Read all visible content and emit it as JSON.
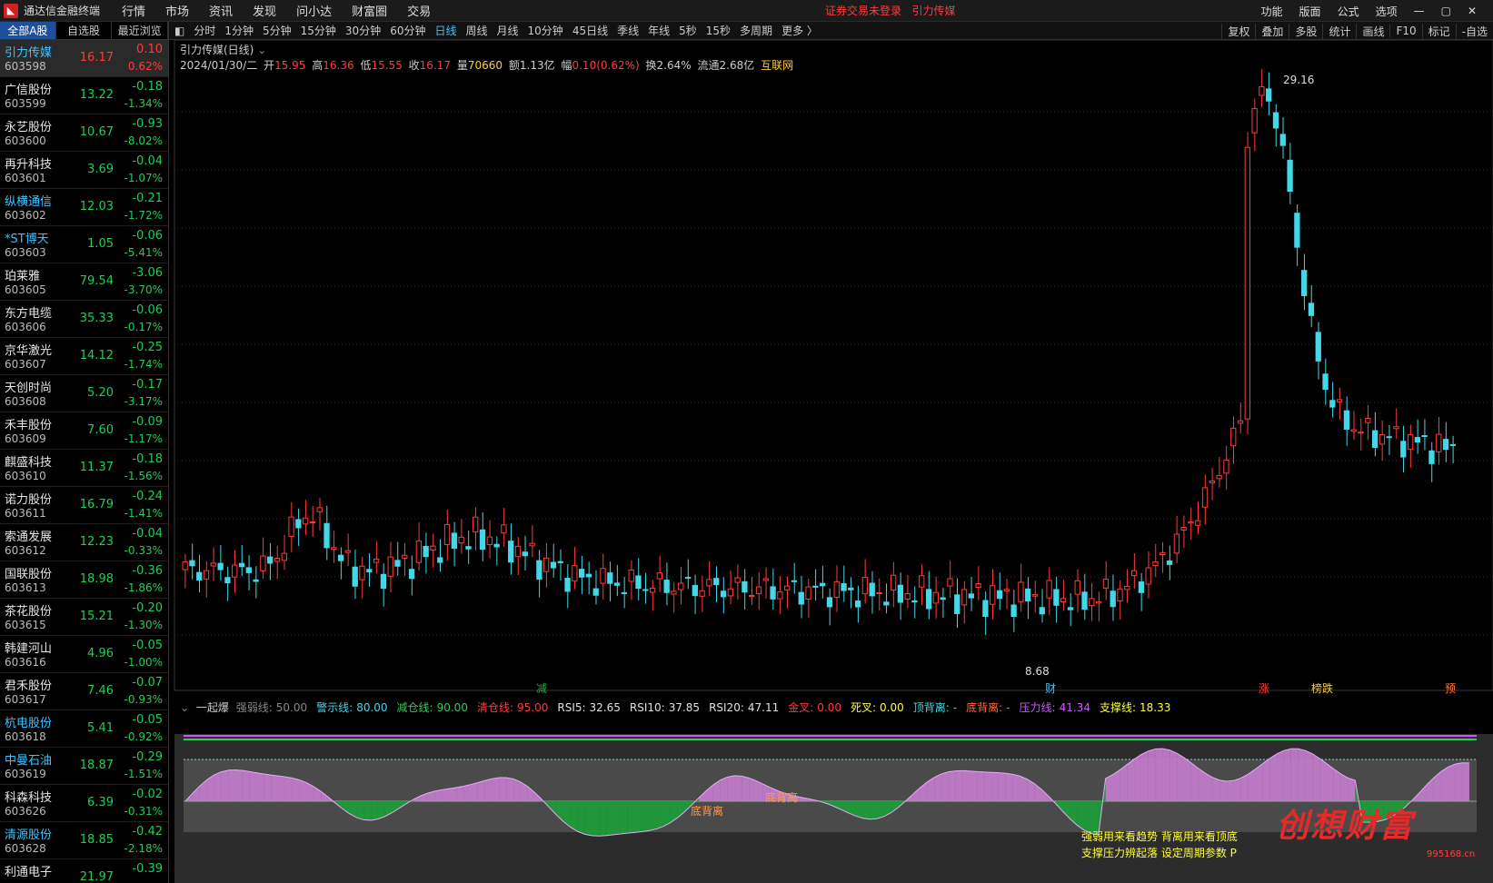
{
  "app": {
    "title": "通达信金融终端",
    "notice": "证券交易未登录",
    "current_stock": "引力传媒"
  },
  "menu": [
    "行情",
    "市场",
    "资讯",
    "发现",
    "问小达",
    "财富圈",
    "交易"
  ],
  "top_right": [
    "功能",
    "版面",
    "公式",
    "选项"
  ],
  "left_tabs": [
    "全部A股",
    "自选股",
    "最近浏览"
  ],
  "stocks": [
    {
      "name": "引力传媒",
      "code": "603598",
      "price": "16.17",
      "chg": "0.10",
      "pct": "0.62%",
      "dir": "up",
      "hl": true,
      "sel": true
    },
    {
      "name": "广信股份",
      "code": "603599",
      "price": "13.22",
      "chg": "-0.18",
      "pct": "-1.34%",
      "dir": "down"
    },
    {
      "name": "永艺股份",
      "code": "603600",
      "price": "10.67",
      "chg": "-0.93",
      "pct": "-8.02%",
      "dir": "down"
    },
    {
      "name": "再升科技",
      "code": "603601",
      "price": "3.69",
      "chg": "-0.04",
      "pct": "-1.07%",
      "dir": "down"
    },
    {
      "name": "纵横通信",
      "code": "603602",
      "price": "12.03",
      "chg": "-0.21",
      "pct": "-1.72%",
      "dir": "down",
      "hl": true
    },
    {
      "name": "*ST博天",
      "code": "603603",
      "price": "1.05",
      "chg": "-0.06",
      "pct": "-5.41%",
      "dir": "down",
      "hl": true
    },
    {
      "name": "珀莱雅",
      "code": "603605",
      "price": "79.54",
      "chg": "-3.06",
      "pct": "-3.70%",
      "dir": "down"
    },
    {
      "name": "东方电缆",
      "code": "603606",
      "price": "35.33",
      "chg": "-0.06",
      "pct": "-0.17%",
      "dir": "down"
    },
    {
      "name": "京华激光",
      "code": "603607",
      "price": "14.12",
      "chg": "-0.25",
      "pct": "-1.74%",
      "dir": "down"
    },
    {
      "name": "天创时尚",
      "code": "603608",
      "price": "5.20",
      "chg": "-0.17",
      "pct": "-3.17%",
      "dir": "down"
    },
    {
      "name": "禾丰股份",
      "code": "603609",
      "price": "7.60",
      "chg": "-0.09",
      "pct": "-1.17%",
      "dir": "down"
    },
    {
      "name": "麒盛科技",
      "code": "603610",
      "price": "11.37",
      "chg": "-0.18",
      "pct": "-1.56%",
      "dir": "down"
    },
    {
      "name": "诺力股份",
      "code": "603611",
      "price": "16.79",
      "chg": "-0.24",
      "pct": "-1.41%",
      "dir": "down"
    },
    {
      "name": "索通发展",
      "code": "603612",
      "price": "12.23",
      "chg": "-0.04",
      "pct": "-0.33%",
      "dir": "down"
    },
    {
      "name": "国联股份",
      "code": "603613",
      "price": "18.98",
      "chg": "-0.36",
      "pct": "-1.86%",
      "dir": "down"
    },
    {
      "name": "茶花股份",
      "code": "603615",
      "price": "15.21",
      "chg": "-0.20",
      "pct": "-1.30%",
      "dir": "down"
    },
    {
      "name": "韩建河山",
      "code": "603616",
      "price": "4.96",
      "chg": "-0.05",
      "pct": "-1.00%",
      "dir": "down"
    },
    {
      "name": "君禾股份",
      "code": "603617",
      "price": "7.46",
      "chg": "-0.07",
      "pct": "-0.93%",
      "dir": "down"
    },
    {
      "name": "杭电股份",
      "code": "603618",
      "price": "5.41",
      "chg": "-0.05",
      "pct": "-0.92%",
      "dir": "down",
      "hl": true
    },
    {
      "name": "中曼石油",
      "code": "603619",
      "price": "18.87",
      "chg": "-0.29",
      "pct": "-1.51%",
      "dir": "down",
      "hl": true
    },
    {
      "name": "科森科技",
      "code": "603626",
      "price": "6.39",
      "chg": "-0.02",
      "pct": "-0.31%",
      "dir": "down"
    },
    {
      "name": "清源股份",
      "code": "603628",
      "price": "18.85",
      "chg": "-0.42",
      "pct": "-2.18%",
      "dir": "down",
      "hl": true
    },
    {
      "name": "利通电子",
      "code": "",
      "price": "21.97",
      "chg": "-0.39",
      "pct": "",
      "dir": "down"
    }
  ],
  "periods": [
    "分时",
    "1分钟",
    "5分钟",
    "15分钟",
    "30分钟",
    "60分钟",
    "日线",
    "周线",
    "月线",
    "10分钟",
    "45日线",
    "季线",
    "年线",
    "5秒",
    "15秒",
    "多周期",
    "更多 〉"
  ],
  "active_period": "日线",
  "period_right": [
    "复权",
    "叠加",
    "多股",
    "统计",
    "画线",
    "F10",
    "标记",
    "-自选"
  ],
  "chart": {
    "title": "引力传媒(日线)",
    "date": "2024/01/30/二",
    "open_label": "开",
    "open": "15.95",
    "high_label": "高",
    "high": "16.36",
    "low_label": "低",
    "low": "15.55",
    "close_label": "收",
    "close": "16.17",
    "vol_label": "量",
    "vol": "70660",
    "amt_label": "额",
    "amt": "1.13亿",
    "amp_label": "幅",
    "amp": "0.10(0.62%)",
    "turn_label": "换",
    "turn": "2.64%",
    "float_label": "流通",
    "float": "2.68亿",
    "sector": "互联网",
    "max_label": "29.16",
    "min_label": "8.68",
    "marks": [
      "减",
      "财",
      "涨",
      "榜跌",
      "预"
    ]
  },
  "indicator": {
    "name": "一起爆",
    "items": [
      {
        "label": "强弱线:",
        "value": "50.00",
        "color": "#888888"
      },
      {
        "label": "警示线:",
        "value": "80.00",
        "color": "#44d7e8"
      },
      {
        "label": "减仓线:",
        "value": "90.00",
        "color": "#2fcf4f"
      },
      {
        "label": "清仓线:",
        "value": "95.00",
        "color": "#ff3b3b"
      },
      {
        "label": "RSI5:",
        "value": "32.65",
        "color": "#e0e0e0"
      },
      {
        "label": "RSI10:",
        "value": "37.85",
        "color": "#e0e0e0"
      },
      {
        "label": "RSI20:",
        "value": "47.11",
        "color": "#e0e0e0"
      },
      {
        "label": "金叉:",
        "value": "0.00",
        "color": "#ff3b3b"
      },
      {
        "label": "死叉:",
        "value": "0.00",
        "color": "#ffff33"
      },
      {
        "label": "顶背离:",
        "value": "-",
        "color": "#44d7e8"
      },
      {
        "label": "底背离:",
        "value": "-",
        "color": "#ff6a3b"
      },
      {
        "label": "压力线:",
        "value": "41.34",
        "color": "#cf55ff"
      },
      {
        "label": "支撑线:",
        "value": "18.33",
        "color": "#ffff33"
      }
    ],
    "div_labels": [
      "底背离",
      "底背离"
    ],
    "note1": "强弱用来看趋势 背离用来看顶底",
    "note2": "支撑压力辨起落 设定周期参数 P"
  },
  "watermark": {
    "text": "创想财富",
    "url": "995168.cn"
  },
  "colors": {
    "up": "#ff3b3b",
    "down": "#44d7e8",
    "sel_tab": "#1d4f9a"
  }
}
